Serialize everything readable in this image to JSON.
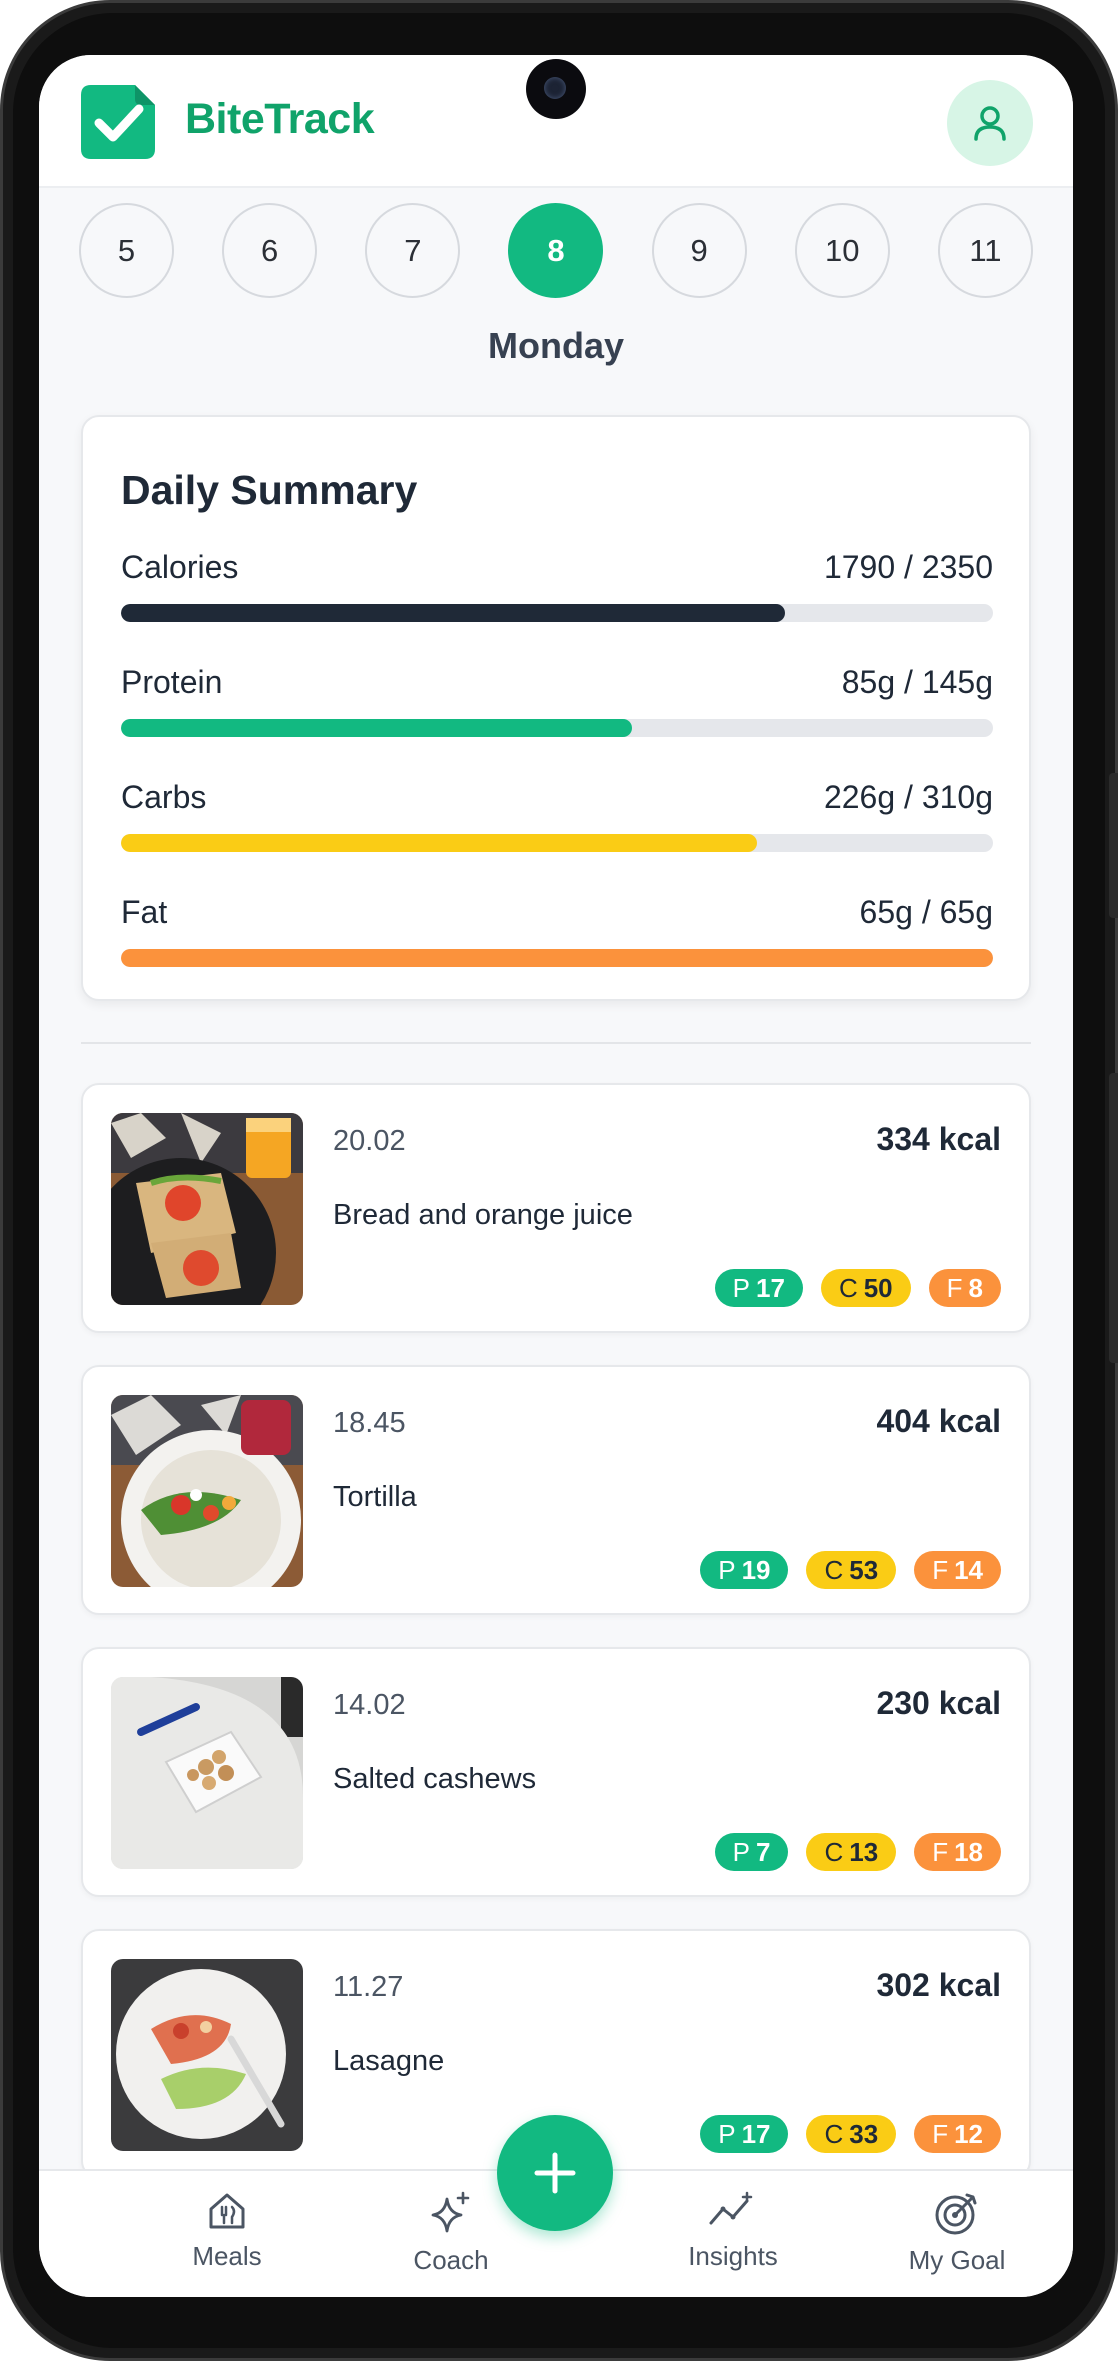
{
  "app": {
    "name": "BiteTrack"
  },
  "day_selector": {
    "days": [
      "5",
      "6",
      "7",
      "8",
      "9",
      "10",
      "11"
    ],
    "active_index": 3,
    "weekday": "Monday"
  },
  "summary": {
    "title": "Daily Summary",
    "macros": [
      {
        "label": "Calories",
        "value_text": "1790 / 2350",
        "current": 1790,
        "goal": 2350,
        "color": "#1f2937"
      },
      {
        "label": "Protein",
        "value_text": "85g / 145g",
        "current": 85,
        "goal": 145,
        "color": "#12b981"
      },
      {
        "label": "Carbs",
        "value_text": "226g / 310g",
        "current": 226,
        "goal": 310,
        "color": "#facc15"
      },
      {
        "label": "Fat",
        "value_text": "65g / 65g",
        "current": 65,
        "goal": 65,
        "color": "#fb923c"
      }
    ]
  },
  "meals": [
    {
      "time": "20.02",
      "name": "Bread and orange juice",
      "kcal": "334 kcal",
      "p": "17",
      "c": "50",
      "f": "8"
    },
    {
      "time": "18.45",
      "name": "Tortilla",
      "kcal": "404 kcal",
      "p": "19",
      "c": "53",
      "f": "14"
    },
    {
      "time": "14.02",
      "name": "Salted cashews",
      "kcal": "230 kcal",
      "p": "7",
      "c": "13",
      "f": "18"
    },
    {
      "time": "11.27",
      "name": "Lasagne",
      "kcal": "302 kcal",
      "p": "17",
      "c": "33",
      "f": "12"
    }
  ],
  "chip_letters": {
    "p": "P",
    "c": "C",
    "f": "F"
  },
  "nav": {
    "meals": "Meals",
    "coach": "Coach",
    "insights": "Insights",
    "goal": "My Goal"
  },
  "colors": {
    "brand": "#10a36a",
    "accent": "#12b981",
    "carbs": "#facc15",
    "fat": "#fb923c"
  },
  "icons": {
    "logo": "check-badge-icon",
    "profile": "user-icon",
    "meals": "home-fork-icon",
    "coach": "sparkles-icon",
    "insights": "trend-line-icon",
    "goal": "target-icon",
    "add": "plus-icon"
  }
}
